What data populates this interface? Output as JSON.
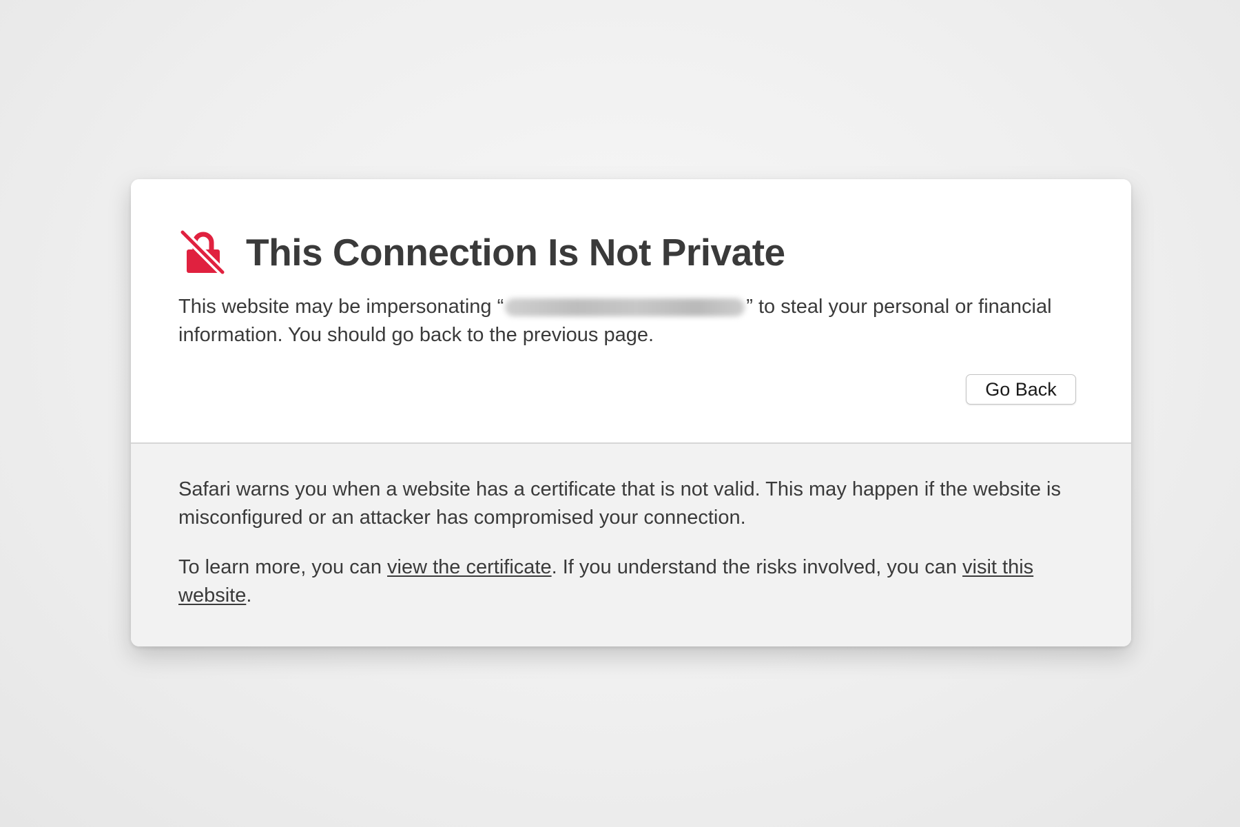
{
  "page": {
    "title": "This Connection Is Not Private",
    "warning_prefix": "This website may be impersonating “",
    "warning_suffix": "” to steal your personal or financial information. You should go back to the previous page.",
    "go_back_label": "Go Back",
    "info_paragraph": "Safari warns you when a website has a certificate that is not valid. This may happen if the website is misconfigured or an attacker has compromised your connection.",
    "learn_prefix": "To learn more, you can ",
    "view_certificate_link": "view the certificate",
    "learn_middle": ". If you understand the risks involved, you can ",
    "visit_website_link": "visit this website",
    "learn_suffix": "."
  },
  "icons": {
    "warning": "broken-lock-icon"
  },
  "colors": {
    "accent": "#e0213f",
    "title_text": "#3a3a3a",
    "background": "#efefef",
    "card_lower": "#f2f2f2"
  }
}
